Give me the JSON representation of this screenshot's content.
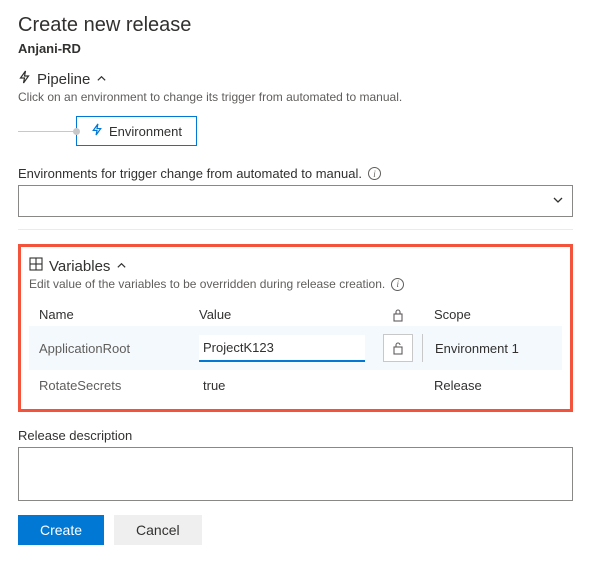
{
  "header": {
    "title": "Create new release",
    "subtitle": "Anjani-RD"
  },
  "pipeline": {
    "section_label": "Pipeline",
    "description": "Click on an environment to change its trigger from automated to manual.",
    "environment_box_label": "Environment",
    "env_dropdown_label": "Environments for trigger change from automated to manual."
  },
  "variables": {
    "section_label": "Variables",
    "description": "Edit value of the variables to be overridden during release creation.",
    "columns": {
      "name": "Name",
      "value": "Value",
      "scope": "Scope"
    },
    "rows": [
      {
        "name": "ApplicationRoot",
        "value": "ProjectK123",
        "scope": "Environment 1",
        "editing": true
      },
      {
        "name": "RotateSecrets",
        "value": "true",
        "scope": "Release",
        "editing": false
      }
    ]
  },
  "release_description": {
    "label": "Release description",
    "value": ""
  },
  "footer": {
    "create": "Create",
    "cancel": "Cancel"
  }
}
